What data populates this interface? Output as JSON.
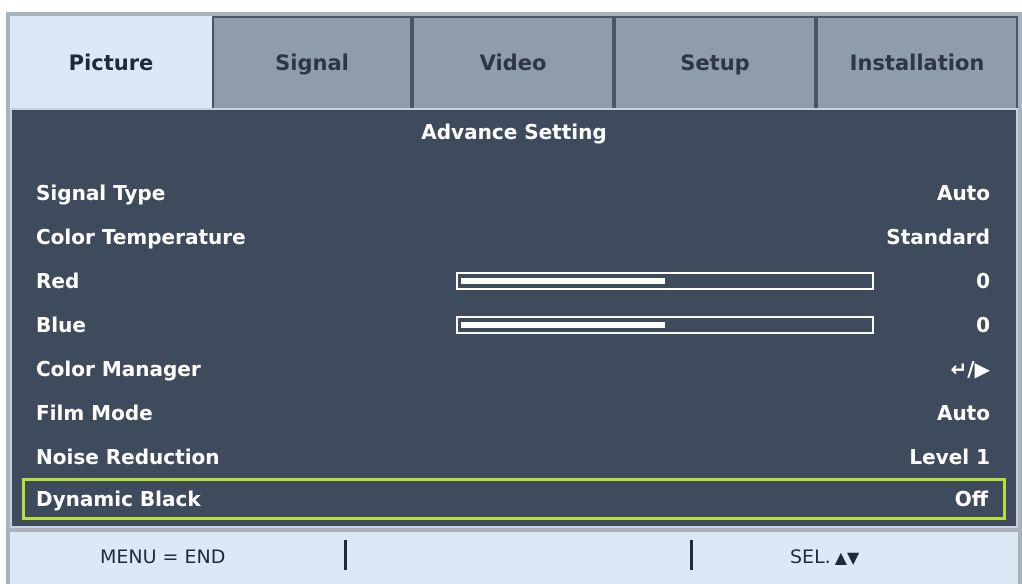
{
  "tabs": [
    {
      "label": "Picture",
      "active": true
    },
    {
      "label": "Signal",
      "active": false
    },
    {
      "label": "Video",
      "active": false
    },
    {
      "label": "Setup",
      "active": false
    },
    {
      "label": "Installation",
      "active": false
    }
  ],
  "content": {
    "title": "Advance Setting",
    "rows": [
      {
        "label": "Signal Type",
        "value": "Auto"
      },
      {
        "label": "Color Temperature",
        "value": "Standard"
      },
      {
        "label": "Red",
        "value": "0",
        "slider_level": 0.5
      },
      {
        "label": "Blue",
        "value": "0",
        "slider_level": 0.5
      },
      {
        "label": "Color Manager",
        "value": "↵/▶"
      },
      {
        "label": "Film Mode",
        "value": "Auto"
      },
      {
        "label": "Noise Reduction",
        "value": "Level 1"
      },
      {
        "label": "Dynamic Black",
        "value": "Off",
        "selected": true
      }
    ]
  },
  "footer": {
    "left": "MENU = END",
    "right": "SEL.",
    "right_icons": "▲▼"
  },
  "colors": {
    "selection_border": "#b6e03b",
    "content_bg": "#3d4b5c",
    "active_tab_bg": "#dbe9f6"
  }
}
